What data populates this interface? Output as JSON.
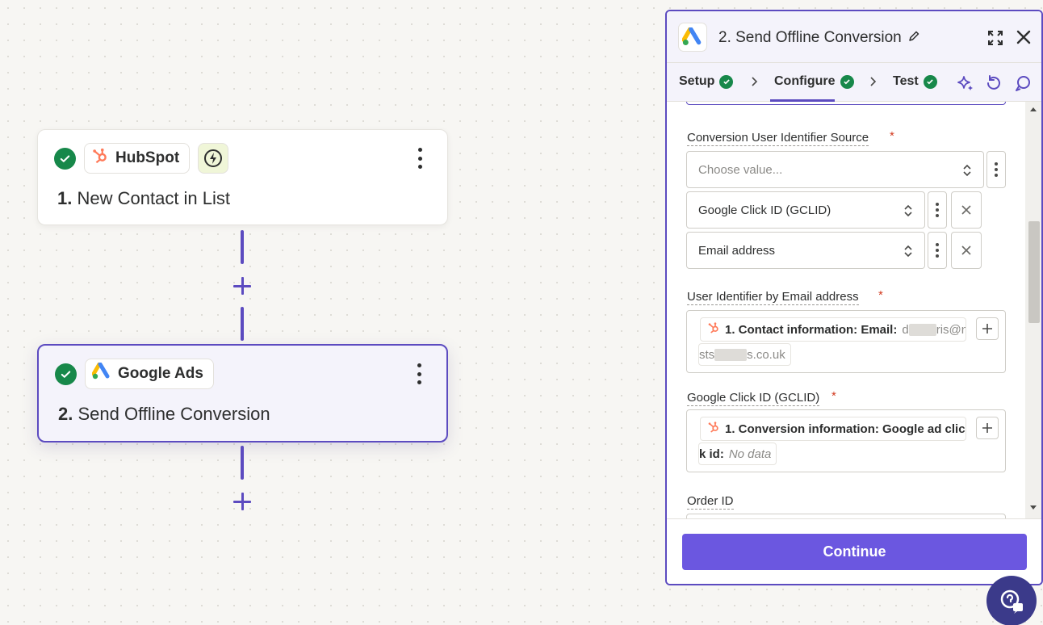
{
  "canvas": {
    "steps": [
      {
        "number": "1.",
        "title": "New Contact in List",
        "app": "HubSpot",
        "icon": "hubspot-icon",
        "status": "complete",
        "trigger_icon": "lightning-icon"
      },
      {
        "number": "2.",
        "title": "Send Offline Conversion",
        "app": "Google Ads",
        "icon": "google-ads-icon",
        "status": "complete",
        "active": true
      }
    ]
  },
  "panel": {
    "title": "2. Send Offline Conversion",
    "tabs": [
      {
        "label": "Setup",
        "status": "complete"
      },
      {
        "label": "Configure",
        "status": "complete",
        "active": true
      },
      {
        "label": "Test",
        "status": "complete"
      }
    ],
    "fields": {
      "identifier_source": {
        "label": "Conversion User Identifier Source",
        "required": "*",
        "placeholder": "Choose value...",
        "selected": [
          "Google Click ID (GCLID)",
          "Email address"
        ]
      },
      "email_identifier": {
        "label": "User Identifier by Email address",
        "required": "*",
        "pill_label": "1. Contact information: Email:",
        "value_start": "d",
        "value_mid": "ris@ne",
        "value_line2_start": "sts",
        "value_line2_end": "s.co.uk"
      },
      "gclid": {
        "label": "Google Click ID (GCLID)",
        "required": "*",
        "pill_label": "1. Conversion information: Google ad clic",
        "pill_label_line2": "k id:",
        "value": "No data"
      },
      "order_id": {
        "label": "Order ID"
      }
    },
    "continue_label": "Continue"
  },
  "colors": {
    "accent": "#5c4bc0",
    "button": "#6b57e0",
    "success": "#17884a",
    "required": "#d23a1f",
    "hubspot": "#ff7a59"
  }
}
